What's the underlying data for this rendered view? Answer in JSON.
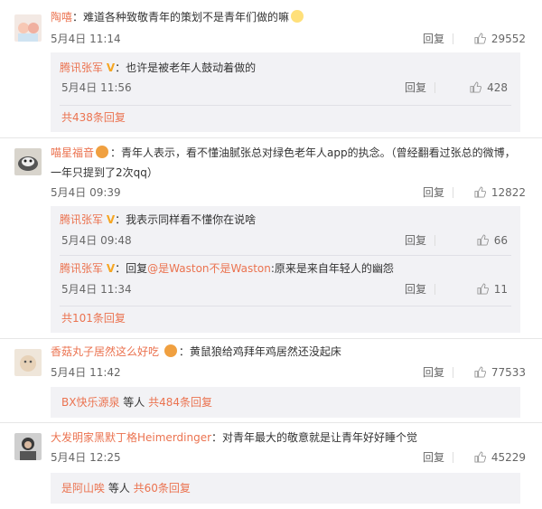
{
  "colors": {
    "accent": "#eb7350",
    "vip": "#f5a623",
    "subbg": "#f2f2f5"
  },
  "icons": {
    "like": "thumbs-up-icon",
    "vip": "v-badge-icon"
  },
  "c1": {
    "user": "陶嘻",
    "text": "：难道各种致敬青年的策划不是青年们做的嘛",
    "time": "5月4日 11:14",
    "reply": "回复",
    "likes": "29552",
    "sub1": {
      "user": "腾讯张军",
      "text": "：也许是被老年人鼓动着做的",
      "time": "5月4日 11:56",
      "reply": "回复",
      "likes": "428"
    },
    "more": "共438条回复"
  },
  "c2": {
    "user": "喵星福音",
    "text": "：青年人表示，看不懂油腻张总对绿色老年人app的执念。（曾经翻看过张总的微博，",
    "text2": "一年只提到了2次qq）",
    "time": "5月4日 09:39",
    "reply": "回复",
    "likes": "12822",
    "sub1": {
      "user": "腾讯张军",
      "text": "：我表示同样看不懂你在说啥",
      "time": "5月4日 09:48",
      "reply": "回复",
      "likes": "66"
    },
    "sub2": {
      "user": "腾讯张军",
      "prefix": "：回复",
      "mention": "@是Waston不是Waston",
      "text": ":原来是来自年轻人的幽怨",
      "time": "5月4日 11:34",
      "reply": "回复",
      "likes": "11"
    },
    "more": "共101条回复"
  },
  "c3": {
    "user": "香菇丸子居然这么好吃",
    "text": "：黄鼠狼给鸡拜年鸡居然还没起床",
    "time": "5月4日 11:42",
    "reply": "回复",
    "likes": "77533",
    "more_user": "BX快乐源泉",
    "more_mid": " 等人 ",
    "more": "共484条回复"
  },
  "c4": {
    "user": "大发明家黑默丁格Heimerdinger",
    "text": "：对青年最大的敬意就是让青年好好睡个觉",
    "time": "5月4日 12:25",
    "reply": "回复",
    "likes": "45229",
    "more_user": "是阿山唉",
    "more_mid": " 等人 ",
    "more": "共60条回复"
  }
}
